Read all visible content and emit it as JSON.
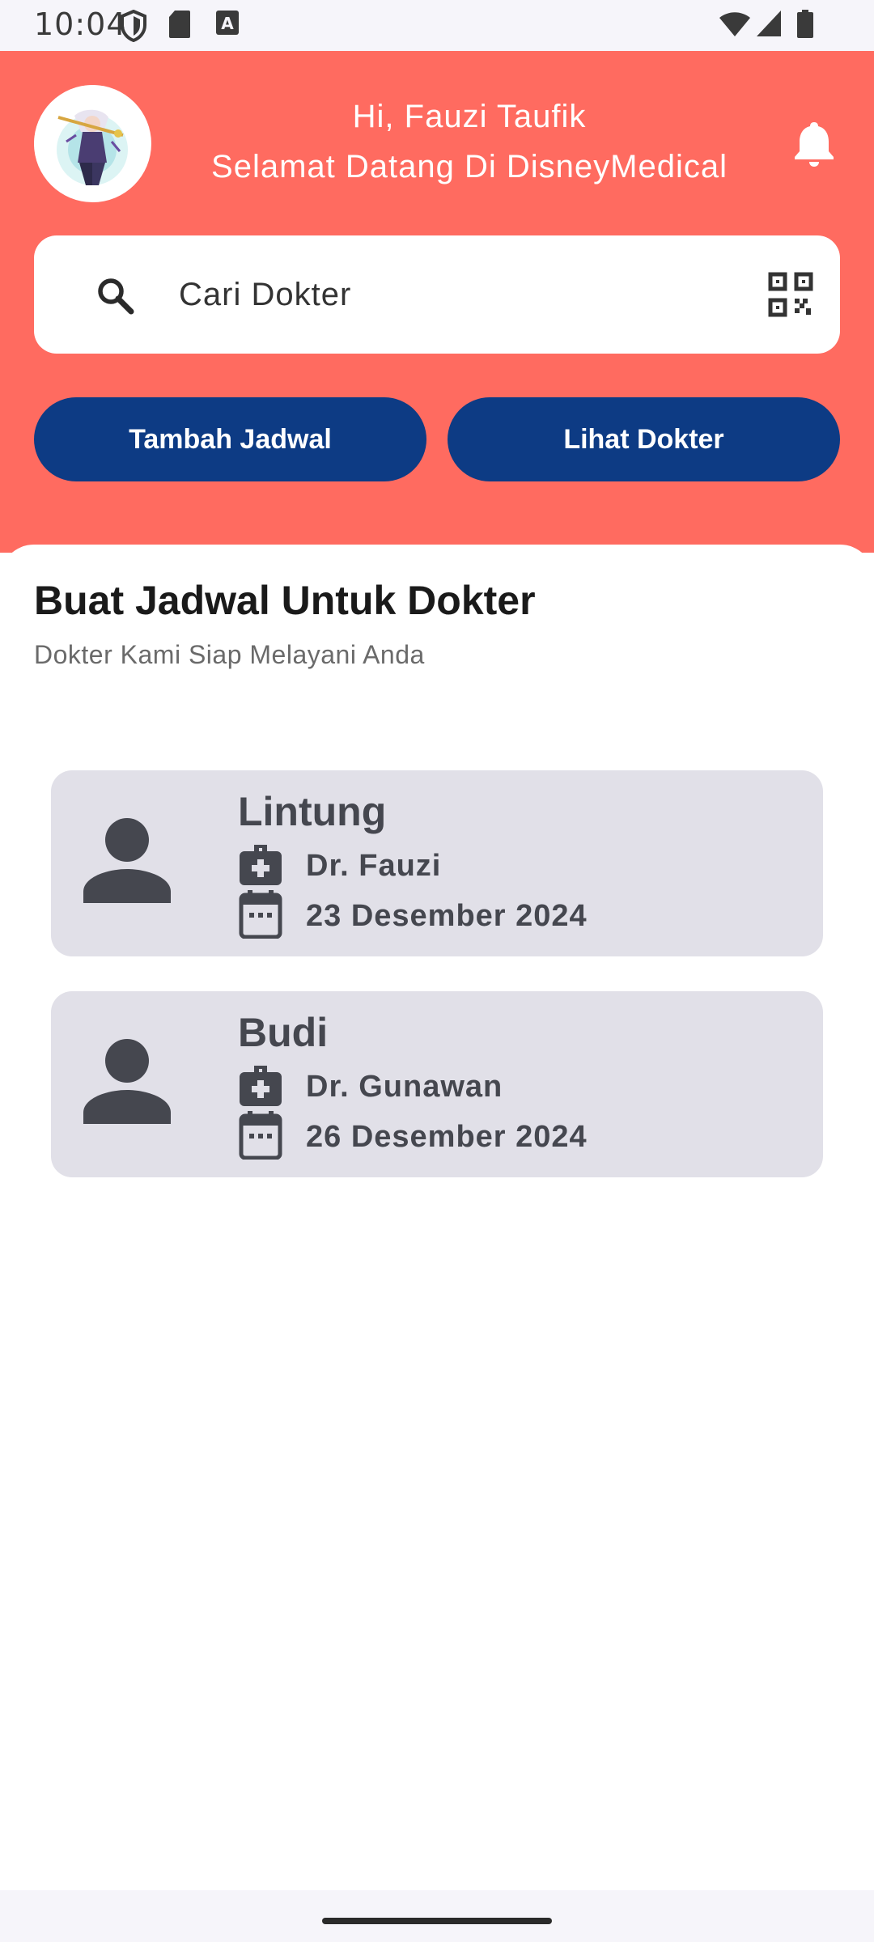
{
  "status_bar": {
    "time": "10:04",
    "left_icons": [
      "shield-icon",
      "sd-card-icon",
      "keyboard-a-icon"
    ],
    "right_icons": [
      "wifi-icon",
      "cellular-signal-icon",
      "battery-icon"
    ]
  },
  "header": {
    "greeting_line1": "Hi, Fauzi Taufik",
    "greeting_line2": "Selamat Datang Di DisneyMedical",
    "avatar_icon": "profile-avatar",
    "notification_icon": "bell-icon",
    "background_color": "#ff6b60"
  },
  "search": {
    "placeholder": "Cari Dokter",
    "value": "",
    "search_icon": "search-icon",
    "scan_icon": "qr-scan-icon"
  },
  "actions": {
    "add_schedule_label": "Tambah Jadwal",
    "view_doctor_label": "Lihat Dokter",
    "button_color": "#0d3b84"
  },
  "main": {
    "title": "Buat Jadwal Untuk Dokter",
    "subtitle": "Dokter Kami Siap Melayani Anda"
  },
  "appointments": [
    {
      "patient": "Lintung",
      "doctor": "Dr. Fauzi",
      "date": "23 Desember 2024"
    },
    {
      "patient": "Budi",
      "doctor": "Dr. Gunawan",
      "date": "26 Desember 2024"
    }
  ]
}
